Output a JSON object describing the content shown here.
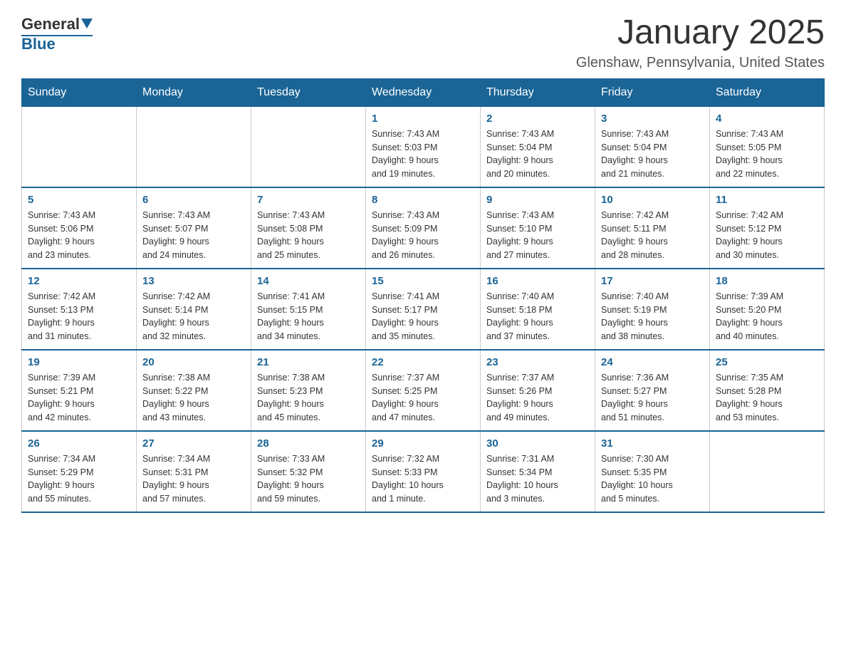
{
  "header": {
    "logo_general": "General",
    "logo_blue": "Blue",
    "title": "January 2025",
    "subtitle": "Glenshaw, Pennsylvania, United States"
  },
  "days_of_week": [
    "Sunday",
    "Monday",
    "Tuesday",
    "Wednesday",
    "Thursday",
    "Friday",
    "Saturday"
  ],
  "weeks": [
    [
      {
        "day": "",
        "info": ""
      },
      {
        "day": "",
        "info": ""
      },
      {
        "day": "",
        "info": ""
      },
      {
        "day": "1",
        "info": "Sunrise: 7:43 AM\nSunset: 5:03 PM\nDaylight: 9 hours\nand 19 minutes."
      },
      {
        "day": "2",
        "info": "Sunrise: 7:43 AM\nSunset: 5:04 PM\nDaylight: 9 hours\nand 20 minutes."
      },
      {
        "day": "3",
        "info": "Sunrise: 7:43 AM\nSunset: 5:04 PM\nDaylight: 9 hours\nand 21 minutes."
      },
      {
        "day": "4",
        "info": "Sunrise: 7:43 AM\nSunset: 5:05 PM\nDaylight: 9 hours\nand 22 minutes."
      }
    ],
    [
      {
        "day": "5",
        "info": "Sunrise: 7:43 AM\nSunset: 5:06 PM\nDaylight: 9 hours\nand 23 minutes."
      },
      {
        "day": "6",
        "info": "Sunrise: 7:43 AM\nSunset: 5:07 PM\nDaylight: 9 hours\nand 24 minutes."
      },
      {
        "day": "7",
        "info": "Sunrise: 7:43 AM\nSunset: 5:08 PM\nDaylight: 9 hours\nand 25 minutes."
      },
      {
        "day": "8",
        "info": "Sunrise: 7:43 AM\nSunset: 5:09 PM\nDaylight: 9 hours\nand 26 minutes."
      },
      {
        "day": "9",
        "info": "Sunrise: 7:43 AM\nSunset: 5:10 PM\nDaylight: 9 hours\nand 27 minutes."
      },
      {
        "day": "10",
        "info": "Sunrise: 7:42 AM\nSunset: 5:11 PM\nDaylight: 9 hours\nand 28 minutes."
      },
      {
        "day": "11",
        "info": "Sunrise: 7:42 AM\nSunset: 5:12 PM\nDaylight: 9 hours\nand 30 minutes."
      }
    ],
    [
      {
        "day": "12",
        "info": "Sunrise: 7:42 AM\nSunset: 5:13 PM\nDaylight: 9 hours\nand 31 minutes."
      },
      {
        "day": "13",
        "info": "Sunrise: 7:42 AM\nSunset: 5:14 PM\nDaylight: 9 hours\nand 32 minutes."
      },
      {
        "day": "14",
        "info": "Sunrise: 7:41 AM\nSunset: 5:15 PM\nDaylight: 9 hours\nand 34 minutes."
      },
      {
        "day": "15",
        "info": "Sunrise: 7:41 AM\nSunset: 5:17 PM\nDaylight: 9 hours\nand 35 minutes."
      },
      {
        "day": "16",
        "info": "Sunrise: 7:40 AM\nSunset: 5:18 PM\nDaylight: 9 hours\nand 37 minutes."
      },
      {
        "day": "17",
        "info": "Sunrise: 7:40 AM\nSunset: 5:19 PM\nDaylight: 9 hours\nand 38 minutes."
      },
      {
        "day": "18",
        "info": "Sunrise: 7:39 AM\nSunset: 5:20 PM\nDaylight: 9 hours\nand 40 minutes."
      }
    ],
    [
      {
        "day": "19",
        "info": "Sunrise: 7:39 AM\nSunset: 5:21 PM\nDaylight: 9 hours\nand 42 minutes."
      },
      {
        "day": "20",
        "info": "Sunrise: 7:38 AM\nSunset: 5:22 PM\nDaylight: 9 hours\nand 43 minutes."
      },
      {
        "day": "21",
        "info": "Sunrise: 7:38 AM\nSunset: 5:23 PM\nDaylight: 9 hours\nand 45 minutes."
      },
      {
        "day": "22",
        "info": "Sunrise: 7:37 AM\nSunset: 5:25 PM\nDaylight: 9 hours\nand 47 minutes."
      },
      {
        "day": "23",
        "info": "Sunrise: 7:37 AM\nSunset: 5:26 PM\nDaylight: 9 hours\nand 49 minutes."
      },
      {
        "day": "24",
        "info": "Sunrise: 7:36 AM\nSunset: 5:27 PM\nDaylight: 9 hours\nand 51 minutes."
      },
      {
        "day": "25",
        "info": "Sunrise: 7:35 AM\nSunset: 5:28 PM\nDaylight: 9 hours\nand 53 minutes."
      }
    ],
    [
      {
        "day": "26",
        "info": "Sunrise: 7:34 AM\nSunset: 5:29 PM\nDaylight: 9 hours\nand 55 minutes."
      },
      {
        "day": "27",
        "info": "Sunrise: 7:34 AM\nSunset: 5:31 PM\nDaylight: 9 hours\nand 57 minutes."
      },
      {
        "day": "28",
        "info": "Sunrise: 7:33 AM\nSunset: 5:32 PM\nDaylight: 9 hours\nand 59 minutes."
      },
      {
        "day": "29",
        "info": "Sunrise: 7:32 AM\nSunset: 5:33 PM\nDaylight: 10 hours\nand 1 minute."
      },
      {
        "day": "30",
        "info": "Sunrise: 7:31 AM\nSunset: 5:34 PM\nDaylight: 10 hours\nand 3 minutes."
      },
      {
        "day": "31",
        "info": "Sunrise: 7:30 AM\nSunset: 5:35 PM\nDaylight: 10 hours\nand 5 minutes."
      },
      {
        "day": "",
        "info": ""
      }
    ]
  ]
}
